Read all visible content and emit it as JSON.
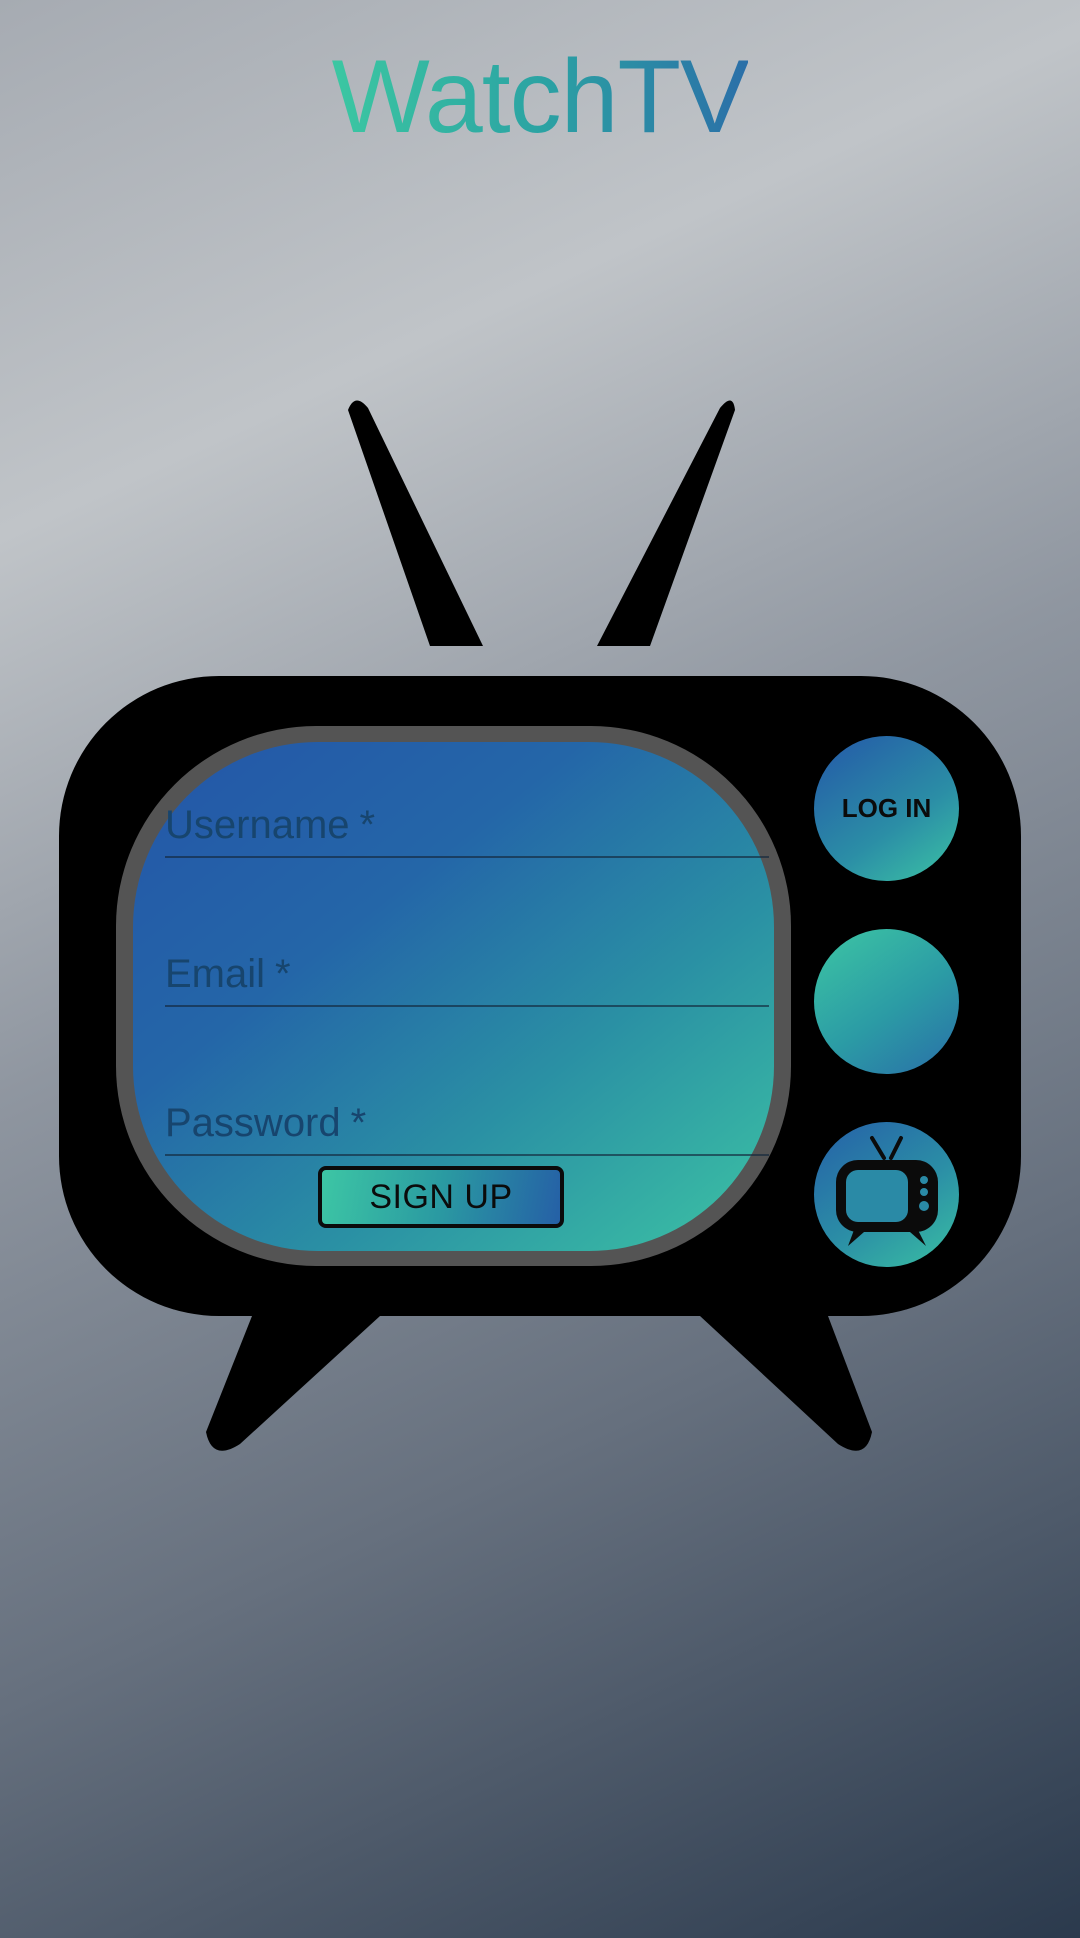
{
  "app": {
    "title": "WatchTV"
  },
  "form": {
    "username_label": "Username",
    "email_label": "Email",
    "password_label": "Password",
    "required_marker": "*",
    "signup_label": "SIGN UP"
  },
  "side_buttons": {
    "login_label": "LOG IN"
  },
  "colors": {
    "accent_green": "#3cc7a2",
    "accent_blue": "#2560a6",
    "tv_body": "#000000",
    "screen_bezel": "#555555"
  },
  "icons": {
    "tv_icon": "tv-icon"
  }
}
